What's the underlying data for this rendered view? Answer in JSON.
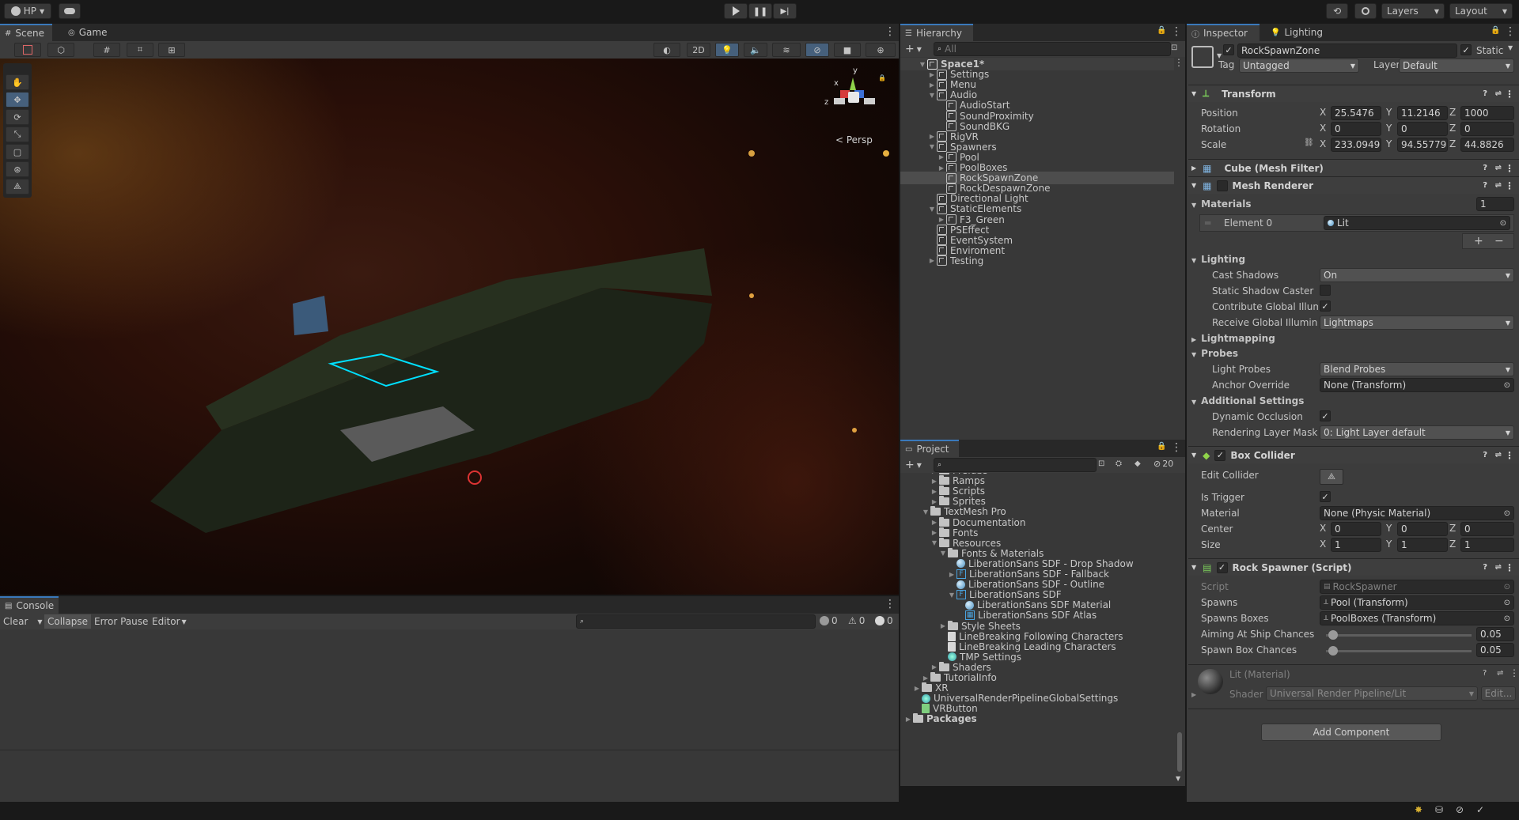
{
  "toolbar": {
    "account": "HP",
    "layers": "Layers",
    "layout": "Layout"
  },
  "scene": {
    "tabs": [
      "Scene",
      "Game"
    ],
    "btn_2d": "2D",
    "persp_label": "< Persp",
    "gizmo_axes": {
      "x": "x",
      "y": "y",
      "z": "z"
    }
  },
  "console": {
    "tab": "Console",
    "clear": "Clear",
    "collapse": "Collapse",
    "error_pause": "Error Pause",
    "editor": "Editor",
    "count_messages": "0",
    "count_warnings": "0",
    "count_errors": "0"
  },
  "hierarchy": {
    "tab": "Hierarchy",
    "search_placeholder": "All",
    "items": [
      {
        "label": "Space1*",
        "depth": 0,
        "arrow": "▼",
        "icon": "unity-icon"
      },
      {
        "label": "Settings",
        "depth": 1,
        "arrow": "▶",
        "icon": "cube-icon"
      },
      {
        "label": "Menu",
        "depth": 1,
        "arrow": "▶",
        "icon": "cube-icon"
      },
      {
        "label": "Audio",
        "depth": 1,
        "arrow": "▼",
        "icon": "cube-icon"
      },
      {
        "label": "AudioStart",
        "depth": 2,
        "arrow": "",
        "icon": "cube-icon"
      },
      {
        "label": "SoundProximity",
        "depth": 2,
        "arrow": "",
        "icon": "cube-icon"
      },
      {
        "label": "SoundBKG",
        "depth": 2,
        "arrow": "",
        "icon": "cube-icon"
      },
      {
        "label": "RigVR",
        "depth": 1,
        "arrow": "▶",
        "icon": "cube-icon"
      },
      {
        "label": "Spawners",
        "depth": 1,
        "arrow": "▼",
        "icon": "cube-icon"
      },
      {
        "label": "Pool",
        "depth": 2,
        "arrow": "▶",
        "icon": "cube-icon"
      },
      {
        "label": "PoolBoxes",
        "depth": 2,
        "arrow": "▶",
        "icon": "cube-icon"
      },
      {
        "label": "RockSpawnZone",
        "depth": 2,
        "arrow": "",
        "icon": "cube-icon"
      },
      {
        "label": "RockDespawnZone",
        "depth": 2,
        "arrow": "",
        "icon": "cube-icon"
      },
      {
        "label": "Directional Light",
        "depth": 1,
        "arrow": "",
        "icon": "cube-icon"
      },
      {
        "label": "StaticElements",
        "depth": 1,
        "arrow": "▼",
        "icon": "cube-icon"
      },
      {
        "label": "F3_Green",
        "depth": 2,
        "arrow": "▶",
        "icon": "cube-icon"
      },
      {
        "label": "PSEffect",
        "depth": 1,
        "arrow": "",
        "icon": "cube-icon"
      },
      {
        "label": "EventSystem",
        "depth": 1,
        "arrow": "",
        "icon": "cube-icon"
      },
      {
        "label": "Enviroment",
        "depth": 1,
        "arrow": "",
        "icon": "cube-icon"
      },
      {
        "label": "Testing",
        "depth": 1,
        "arrow": "▶",
        "icon": "cube-icon"
      }
    ]
  },
  "project": {
    "tab": "Project",
    "hidden_count": "20",
    "items": [
      {
        "label": "Prefabs",
        "depth": 3,
        "arrow": "▶",
        "icon": "folder-icon"
      },
      {
        "label": "Ramps",
        "depth": 3,
        "arrow": "▶",
        "icon": "folder-icon"
      },
      {
        "label": "Scripts",
        "depth": 3,
        "arrow": "▶",
        "icon": "folder-icon"
      },
      {
        "label": "Sprites",
        "depth": 3,
        "arrow": "▶",
        "icon": "folder-icon"
      },
      {
        "label": "TextMesh Pro",
        "depth": 2,
        "arrow": "▼",
        "icon": "folder-icon"
      },
      {
        "label": "Documentation",
        "depth": 3,
        "arrow": "▶",
        "icon": "folder-icon"
      },
      {
        "label": "Fonts",
        "depth": 3,
        "arrow": "▶",
        "icon": "folder-icon"
      },
      {
        "label": "Resources",
        "depth": 3,
        "arrow": "▼",
        "icon": "folder-icon"
      },
      {
        "label": "Fonts & Materials",
        "depth": 4,
        "arrow": "▼",
        "icon": "folder-icon"
      },
      {
        "label": "LiberationSans SDF - Drop Shadow",
        "depth": 5,
        "arrow": "",
        "icon": "material-icon"
      },
      {
        "label": "LiberationSans SDF - Fallback",
        "depth": 5,
        "arrow": "▶",
        "icon": "font-asset-icon"
      },
      {
        "label": "LiberationSans SDF - Outline",
        "depth": 5,
        "arrow": "",
        "icon": "material-icon"
      },
      {
        "label": "LiberationSans SDF",
        "depth": 5,
        "arrow": "▼",
        "icon": "font-asset-icon"
      },
      {
        "label": "LiberationSans SDF Material",
        "depth": 6,
        "arrow": "",
        "icon": "material-icon"
      },
      {
        "label": "LiberationSans SDF Atlas",
        "depth": 6,
        "arrow": "",
        "icon": "texture-icon"
      },
      {
        "label": "Style Sheets",
        "depth": 4,
        "arrow": "▶",
        "icon": "folder-icon"
      },
      {
        "label": "LineBreaking Following Characters",
        "depth": 4,
        "arrow": "",
        "icon": "text-asset-icon"
      },
      {
        "label": "LineBreaking Leading Characters",
        "depth": 4,
        "arrow": "",
        "icon": "text-asset-icon"
      },
      {
        "label": "TMP Settings",
        "depth": 4,
        "arrow": "",
        "icon": "settings-asset-icon"
      },
      {
        "label": "Shaders",
        "depth": 3,
        "arrow": "▶",
        "icon": "folder-icon"
      },
      {
        "label": "TutorialInfo",
        "depth": 2,
        "arrow": "▶",
        "icon": "folder-icon"
      },
      {
        "label": "XR",
        "depth": 1,
        "arrow": "▶",
        "icon": "folder-icon"
      },
      {
        "label": "UniversalRenderPipelineGlobalSettings",
        "depth": 1,
        "arrow": "",
        "icon": "settings-asset-icon"
      },
      {
        "label": "VRButton",
        "depth": 1,
        "arrow": "",
        "icon": "script-icon"
      },
      {
        "label": "Packages",
        "depth": 0,
        "arrow": "▶",
        "icon": "folder-icon"
      }
    ]
  },
  "inspector": {
    "tabs": [
      "Inspector",
      "Lighting"
    ],
    "object_name": "RockSpawnZone",
    "static_label": "Static",
    "tag_label": "Tag",
    "tag_value": "Untagged",
    "layer_label": "Layer",
    "layer_value": "Default",
    "transform": {
      "title": "Transform",
      "position_label": "Position",
      "rotation_label": "Rotation",
      "scale_label": "Scale",
      "position": {
        "x": "25.5476",
        "y": "11.2146",
        "z": "1000"
      },
      "rotation": {
        "x": "0",
        "y": "0",
        "z": "0"
      },
      "scale": {
        "x": "233.0949",
        "y": "94.55779",
        "z": "44.8826"
      }
    },
    "mesh_filter_title": "Cube (Mesh Filter)",
    "mesh_renderer": {
      "title": "Mesh Renderer",
      "materials_label": "Materials",
      "materials_count": "1",
      "element0_label": "Element 0",
      "element0_value": "Lit",
      "lighting_label": "Lighting",
      "cast_shadows_label": "Cast Shadows",
      "cast_shadows_value": "On",
      "static_shadow_label": "Static Shadow Caster",
      "contribute_gi_label": "Contribute Global Illumin",
      "receive_gi_label": "Receive Global Illuminat",
      "receive_gi_value": "Lightmaps",
      "lightmapping_label": "Lightmapping",
      "probes_label": "Probes",
      "light_probes_label": "Light Probes",
      "light_probes_value": "Blend Probes",
      "anchor_override_label": "Anchor Override",
      "anchor_override_value": "None (Transform)",
      "additional_label": "Additional Settings",
      "dynamic_occlusion_label": "Dynamic Occlusion",
      "rendering_layer_label": "Rendering Layer Mask",
      "rendering_layer_value": "0: Light Layer default"
    },
    "box_collider": {
      "title": "Box Collider",
      "edit_collider_label": "Edit Collider",
      "is_trigger_label": "Is Trigger",
      "material_label": "Material",
      "material_value": "None (Physic Material)",
      "center_label": "Center",
      "size_label": "Size",
      "center": {
        "x": "0",
        "y": "0",
        "z": "0"
      },
      "size": {
        "x": "1",
        "y": "1",
        "z": "1"
      }
    },
    "rock_spawner": {
      "title": "Rock Spawner (Script)",
      "script_label": "Script",
      "script_value": "RockSpawner",
      "spawns_label": "Spawns",
      "spawns_value": "Pool (Transform)",
      "spawns_boxes_label": "Spawns Boxes",
      "spawns_boxes_value": "PoolBoxes (Transform)",
      "aiming_label": "Aiming At Ship Chances",
      "aiming_value": "0.05",
      "spawn_box_label": "Spawn Box Chances",
      "spawn_box_value": "0.05",
      "aiming_fraction": 0.05,
      "spawn_box_fraction": 0.05
    },
    "material": {
      "title": "Lit (Material)",
      "shader_label": "Shader",
      "shader_value": "Universal Render Pipeline/Lit",
      "edit_label": "Edit..."
    },
    "add_component": "Add Component"
  },
  "colors": {
    "accent": "#3a79bb",
    "selection": "#2c5d87",
    "panel": "#383838",
    "cyan_outline": "#00e0ff"
  }
}
